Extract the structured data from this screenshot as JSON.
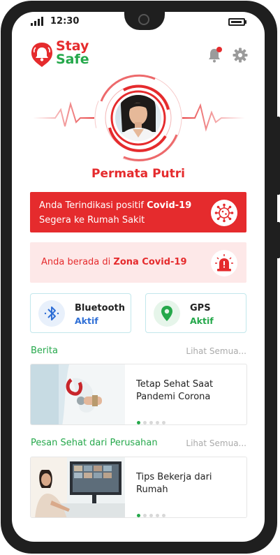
{
  "status_bar": {
    "time": "12:30"
  },
  "brand": {
    "line1": "Stay",
    "line2": "Safe"
  },
  "header_icons": {
    "notification": "bell-icon",
    "settings": "gear-icon",
    "notification_dot": true
  },
  "profile": {
    "name": "Permata Putri"
  },
  "alert_positive": {
    "text_prefix": "Anda Terindikasi positif ",
    "text_bold": "Covid-19",
    "line2": "Segera ke Rumah Sakit",
    "icon": "virus-icon"
  },
  "alert_zone": {
    "text_prefix": "Anda berada di ",
    "text_bold": "Zona Covid-19",
    "icon": "siren-icon"
  },
  "bluetooth": {
    "title": "Bluetooth",
    "status": "Aktif",
    "icon": "bluetooth-icon"
  },
  "gps": {
    "title": "GPS",
    "status": "Aktif",
    "icon": "location-pin-icon"
  },
  "news_section": {
    "title": "Berita",
    "see_all": "Lihat Semua...",
    "card": {
      "title": "Tetap Sehat Saat Pandemi Corona",
      "active_dot": 0,
      "dots": 5
    }
  },
  "company_section": {
    "title": "Pesan Sehat dari Perusahan",
    "see_all": "Lihat Semua...",
    "card": {
      "title": "Tips Bekerja dari Rumah",
      "active_dot": 0,
      "dots": 5
    }
  },
  "colors": {
    "red": "#e52b2d",
    "green": "#25a84b",
    "blue": "#2f6fd6",
    "pink": "#fde8e8",
    "frame": "#1f1f1f"
  }
}
